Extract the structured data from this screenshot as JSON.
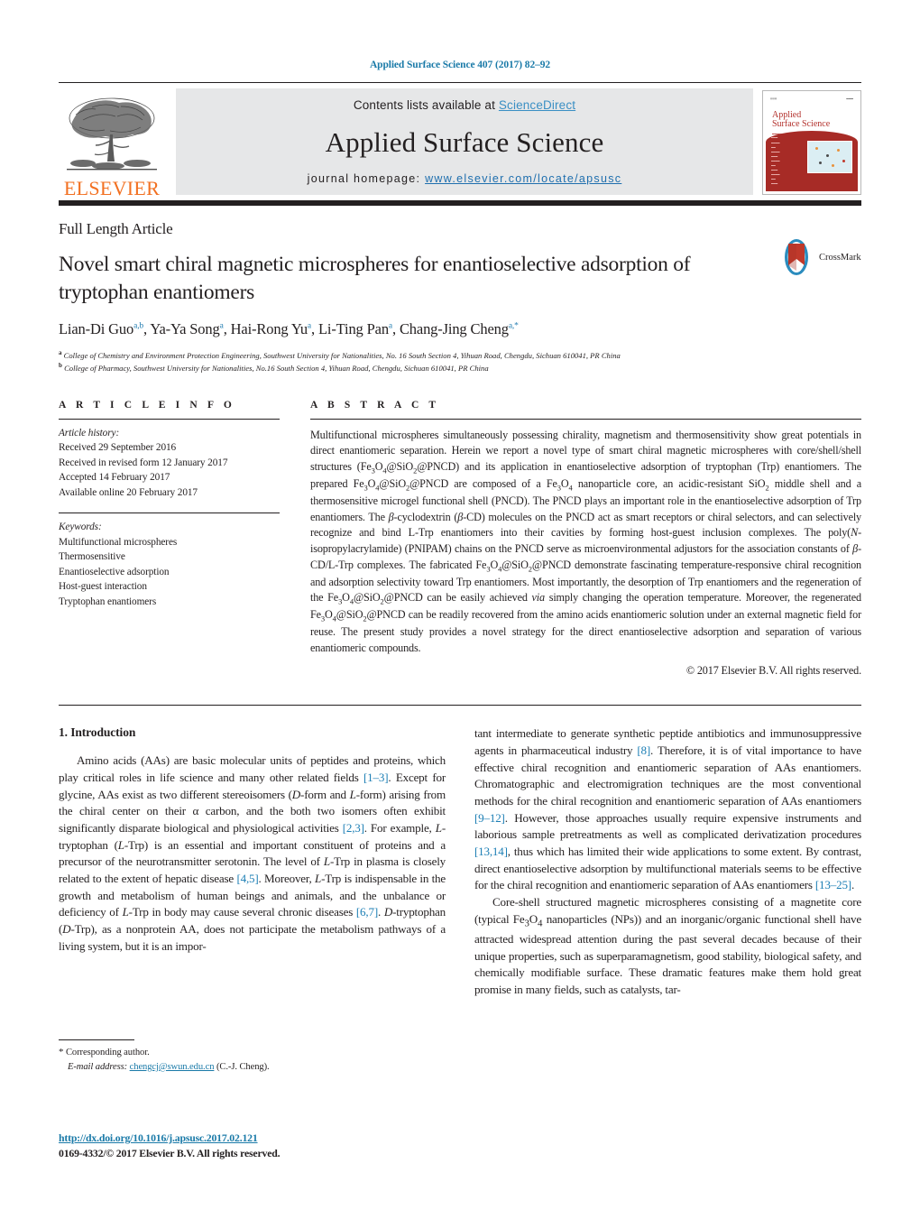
{
  "running_head": "Applied Surface Science 407 (2017) 82–92",
  "masthead": {
    "contents_prefix": "Contents lists available at ",
    "sciencedirect": "ScienceDirect",
    "journal_title": "Applied Surface Science",
    "homepage_prefix": "journal homepage: ",
    "homepage_url": "www.elsevier.com/locate/apsusc",
    "publisher_logo_text": "ELSEVIER",
    "cover": {
      "name_line1": "Applied",
      "name_line2": "Surface Science",
      "accent_color": "#a72b26"
    },
    "band_bg": "#e6e7e8",
    "link_color": "#3a8fc4"
  },
  "article": {
    "type_label": "Full Length Article",
    "title": "Novel smart chiral magnetic microspheres for enantioselective adsorption of tryptophan enantiomers",
    "authors": [
      {
        "name": "Lian-Di Guo",
        "sup": "a,b"
      },
      {
        "name": "Ya-Ya Song",
        "sup": "a"
      },
      {
        "name": "Hai-Rong Yu",
        "sup": "a"
      },
      {
        "name": "Li-Ting Pan",
        "sup": "a"
      },
      {
        "name": "Chang-Jing Cheng",
        "sup": "a,*"
      }
    ],
    "affiliations": [
      {
        "marker": "a",
        "text": "College of Chemistry and Environment Protection Engineering, Southwest University for Nationalities, No. 16 South Section 4, Yihuan Road, Chengdu, Sichuan 610041, PR China"
      },
      {
        "marker": "b",
        "text": "College of Pharmacy, Southwest University for Nationalities, No.16 South Section 4, Yihuan Road, Chengdu, Sichuan 610041, PR China"
      }
    ],
    "crossmark_label": "CrossMark"
  },
  "article_info": {
    "heading": "A R T I C L E    I N F O",
    "history_label": "Article history:",
    "history": [
      "Received 29 September 2016",
      "Received in revised form 12 January 2017",
      "Accepted 14 February 2017",
      "Available online 20 February 2017"
    ],
    "keywords_label": "Keywords:",
    "keywords": [
      "Multifunctional microspheres",
      "Thermosensitive",
      "Enantioselective adsorption",
      "Host-guest interaction",
      "Tryptophan enantiomers"
    ]
  },
  "abstract": {
    "heading": "A B S T R A C T",
    "paragraph_html": "Multifunctional microspheres simultaneously possessing chirality, magnetism and thermosensitivity show great potentials in direct enantiomeric separation. Herein we report a novel type of smart chiral magnetic microspheres with core/shell/shell structures (Fe<sub>3</sub>O<sub>4</sub>@SiO<sub>2</sub>@PNCD) and its application in enantioselective adsorption of tryptophan (Trp) enantiomers. The prepared Fe<sub>3</sub>O<sub>4</sub>@SiO<sub>2</sub>@PNCD are composed of a Fe<sub>3</sub>O<sub>4</sub> nanoparticle core, an acidic-resistant SiO<sub>2</sub> middle shell and a thermosensitive microgel functional shell (PNCD). The PNCD plays an important role in the enantioselective adsorption of Trp enantiomers. The <i>&beta;</i>-cyclodextrin (<i>&beta;</i>-CD) molecules on the PNCD act as smart receptors or chiral selectors, and can selectively recognize and bind L-Trp enantiomers into their cavities by forming host-guest inclusion complexes. The poly(<i>N</i>-isopropylacrylamide) (PNIPAM) chains on the PNCD serve as microenvironmental adjustors for the association constants of <i>&beta;</i>-CD/L-Trp complexes. The fabricated Fe<sub>3</sub>O<sub>4</sub>@SiO<sub>2</sub>@PNCD demonstrate fascinating temperature-responsive chiral recognition and adsorption selectivity toward Trp enantiomers. Most importantly, the desorption of Trp enantiomers and the regeneration of the Fe<sub>3</sub>O<sub>4</sub>@SiO<sub>2</sub>@PNCD can be easily achieved <i>via</i> simply changing the operation temperature. Moreover, the regenerated Fe<sub>3</sub>O<sub>4</sub>@SiO<sub>2</sub>@PNCD can be readily recovered from the amino acids enantiomeric solution under an external magnetic field for reuse. The present study provides a novel strategy for the direct enantioselective adsorption and separation of various enantiomeric compounds.",
    "copyright": "© 2017 Elsevier B.V. All rights reserved."
  },
  "body": {
    "section_heading": "1.  Introduction",
    "left_paragraphs_html": [
      "Amino acids (AAs) are basic molecular units of peptides and proteins, which play critical roles in life science and many other related fields <span class=\"ref\">[1–3]</span>. Except for glycine, AAs exist as two different stereoisomers (<i>D</i>-form and <i>L</i>-form) arising from the chiral center on their &alpha; carbon, and the both two isomers often exhibit significantly disparate biological and physiological activities <span class=\"ref\">[2,3]</span>. For example, <i>L</i>-tryptophan (<i>L</i>-Trp) is an essential and important constituent of proteins and a precursor of the neurotransmitter serotonin. The level of <i>L</i>-Trp in plasma is closely related to the extent of hepatic disease <span class=\"ref\">[4,5]</span>. Moreover, <i>L</i>-Trp is indispensable in the growth and metabolism of human beings and animals, and the unbalance or deficiency of <i>L</i>-Trp in body may cause several chronic diseases <span class=\"ref\">[6,7]</span>. <i>D</i>-tryptophan (<i>D</i>-Trp), as a nonprotein AA, does not participate the metabolism pathways of a living system, but it is an impor-"
    ],
    "right_paragraphs_html": [
      "tant intermediate to generate synthetic peptide antibiotics and immunosuppressive agents in pharmaceutical industry <span class=\"ref\">[8]</span>. Therefore, it is of vital importance to have effective chiral recognition and enantiomeric separation of AAs enantiomers. Chromatographic and electromigration techniques are the most conventional methods for the chiral recognition and enantiomeric separation of AAs enantiomers <span class=\"ref\">[9–12]</span>. However, those approaches usually require expensive instruments and laborious sample pretreatments as well as complicated derivatization procedures <span class=\"ref\">[13,14]</span>, thus which has limited their wide applications to some extent. By contrast, direct enantioselective adsorption by multifunctional materials seems to be effective for the chiral recognition and enantiomeric separation of AAs enantiomers <span class=\"ref\">[13–25]</span>.",
      "Core-shell structured magnetic microspheres consisting of a magnetite core (typical Fe<sub>3</sub>O<sub>4</sub> nanoparticles (NPs)) and an inorganic/organic functional shell have attracted widespread attention during the past several decades because of their unique properties, such as superparamagnetism, good stability, biological safety, and chemically modifiable surface. These dramatic features make them hold great promise in many fields, such as catalysts, tar-"
    ]
  },
  "footnotes": {
    "corresponding_marker": "*",
    "corresponding_text": "Corresponding author.",
    "email_label": "E-mail address:",
    "email": "chengcj@swun.edu.cn",
    "email_suffix": "(C.-J. Cheng)."
  },
  "footer": {
    "doi": "http://dx.doi.org/10.1016/j.apsusc.2017.02.121",
    "issn_line": "0169-4332/© 2017 Elsevier B.V. All rights reserved."
  },
  "colors": {
    "link": "#1a7aa8",
    "elsevier_orange": "#f27021",
    "cover_red": "#a72b26"
  }
}
